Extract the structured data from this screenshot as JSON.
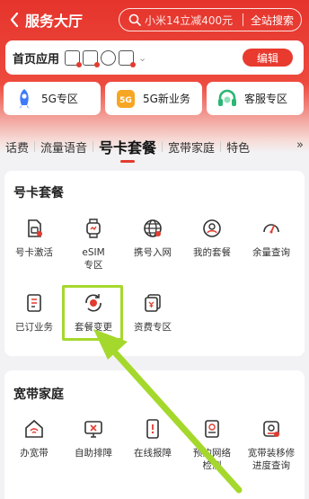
{
  "header": {
    "title": "服务大厅",
    "search_placeholder": "小米14立减400元",
    "search_button": "全站搜索"
  },
  "home_apps": {
    "label": "首页应用",
    "edit_label": "编辑"
  },
  "zones": [
    {
      "label": "5G专区",
      "icon": "rocket-icon"
    },
    {
      "label": "5G新业务",
      "icon": "5g-phone-icon"
    },
    {
      "label": "客服专区",
      "icon": "headset-icon"
    }
  ],
  "tabs": [
    "话费",
    "流量语音",
    "号卡套餐",
    "宽带家庭",
    "特色"
  ],
  "active_tab": "号卡套餐",
  "more_label": "»",
  "section1": {
    "title": "号卡套餐",
    "items": [
      {
        "label": "号卡激活",
        "icon": "sim-card-icon"
      },
      {
        "label": "eSIM\n专区",
        "icon": "watch-icon"
      },
      {
        "label": "携号入网",
        "icon": "globe-icon"
      },
      {
        "label": "我的套餐",
        "icon": "user-badge-icon"
      },
      {
        "label": "余量查询",
        "icon": "gauge-icon"
      },
      {
        "label": "已订业务",
        "icon": "document-icon"
      },
      {
        "label": "套餐变更",
        "icon": "plan-switch-icon"
      },
      {
        "label": "资费专区",
        "icon": "tariff-icon"
      }
    ]
  },
  "section2": {
    "title": "宽带家庭",
    "items": [
      {
        "label": "办宽带",
        "icon": "home-wifi-icon"
      },
      {
        "label": "自助排障",
        "icon": "monitor-repair-icon"
      },
      {
        "label": "在线报障",
        "icon": "phone-report-icon"
      },
      {
        "label": "预约网络\n检测",
        "icon": "checklist-icon"
      },
      {
        "label": "宽带装移修\n进度查询",
        "icon": "router-progress-icon"
      }
    ]
  },
  "colors": {
    "brand": "#e5342c",
    "highlight": "#a5d82c",
    "text": "#222222"
  }
}
